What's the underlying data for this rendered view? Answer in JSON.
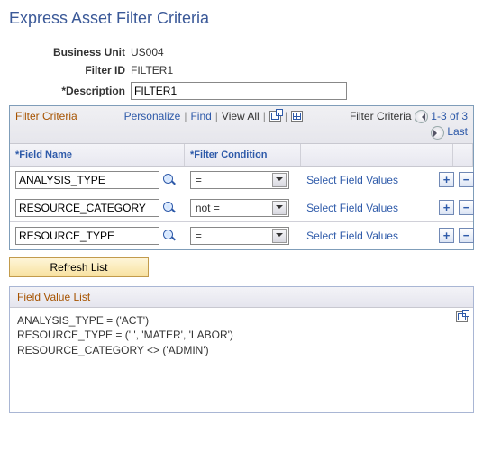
{
  "page": {
    "title": "Express Asset Filter Criteria"
  },
  "header": {
    "business_unit": {
      "label": "Business Unit",
      "value": "US004"
    },
    "filter_id": {
      "label": "Filter ID",
      "value": "FILTER1"
    },
    "description": {
      "label": "*Description",
      "value": "FILTER1"
    }
  },
  "grid": {
    "title": "Filter Criteria",
    "actions": {
      "personalize": "Personalize",
      "find": "Find",
      "view_all": "View All"
    },
    "nav": {
      "label": "Filter Criteria",
      "range": "1-3 of 3",
      "last": "Last"
    },
    "columns": {
      "field_name": "*Field Name",
      "filter_condition": "*Filter Condition"
    },
    "select_values_label": "Select Field Values",
    "rows": [
      {
        "field_name": "ANALYSIS_TYPE",
        "condition": "="
      },
      {
        "field_name": "RESOURCE_CATEGORY",
        "condition": "not ="
      },
      {
        "field_name": "RESOURCE_TYPE",
        "condition": "="
      }
    ]
  },
  "buttons": {
    "refresh_list": "Refresh List"
  },
  "field_value_list": {
    "title": "Field Value List",
    "lines": [
      "ANALYSIS_TYPE = ('ACT')",
      "RESOURCE_TYPE = (' ', 'MATER', 'LABOR')",
      "RESOURCE_CATEGORY <> ('ADMIN')"
    ]
  }
}
